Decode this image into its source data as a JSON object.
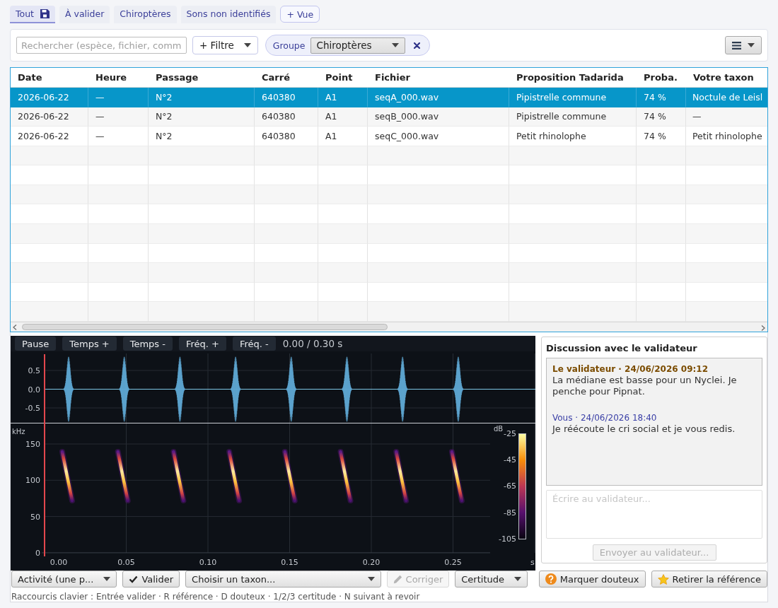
{
  "view_tabs": [
    {
      "label": "Tout",
      "selected": true,
      "saved": true
    },
    {
      "label": "À valider",
      "selected": false,
      "saved": false
    },
    {
      "label": "Chiroptères",
      "selected": false,
      "saved": false
    },
    {
      "label": "Sons non identifiés",
      "selected": false,
      "saved": false
    }
  ],
  "add_view_button": "+ Vue",
  "filter_bar": {
    "search": {
      "placeholder": "Rechercher (espèce, fichier, comm"
    },
    "filter_button": "+ Filtre",
    "chips": [
      {
        "label": "Groupe",
        "value": "Chiroptères"
      }
    ]
  },
  "table": {
    "columns": [
      "Date",
      "Heure",
      "Passage",
      "Carré",
      "Point",
      "Fichier",
      "Proposition Tadarida",
      "Proba.",
      "Votre taxon"
    ],
    "rows": [
      {
        "selected": true,
        "cells": [
          "2026-06-22",
          "—",
          "N°2",
          "640380",
          "A1",
          "seqA_000.wav",
          "Pipistrelle commune",
          "74 %",
          "Noctule de Leisl"
        ]
      },
      {
        "selected": false,
        "cells": [
          "2026-06-22",
          "—",
          "N°2",
          "640380",
          "A1",
          "seqB_000.wav",
          "Pipistrelle commune",
          "74 %",
          "—"
        ]
      },
      {
        "selected": false,
        "cells": [
          "2026-06-22",
          "—",
          "N°2",
          "640380",
          "A1",
          "seqC_000.wav",
          "Petit rhinolophe",
          "74 %",
          "Petit rhinolophe"
        ]
      }
    ]
  },
  "player": {
    "buttons": [
      "Pause",
      "Temps +",
      "Temps -",
      "Fréq. +",
      "Fréq. -"
    ],
    "time": "0.00 / 0.30 s",
    "waveform": {
      "yticks": [
        "0.5",
        "0.0",
        "-0.5"
      ]
    },
    "spectrogram": {
      "yunit": "kHz",
      "yticks": [
        "150",
        "100",
        "50",
        "0"
      ],
      "xticks": [
        "0.00",
        "0.05",
        "0.10",
        "0.15",
        "0.20",
        "0.25"
      ],
      "xunit": "s",
      "colorbar": {
        "unit": "dB",
        "ticks": [
          "-25",
          "-45",
          "-65",
          "-85",
          "-105"
        ]
      }
    }
  },
  "discussion": {
    "title": "Discussion avec le validateur",
    "messages": [
      {
        "kind": "validator",
        "header": "Le validateur · 24/06/2026 09:12",
        "text": "La médiane est basse pour un Nyclei. Je penche pour Pipnat."
      },
      {
        "kind": "self",
        "header": "Vous · 24/06/2026 18:40",
        "text": "Je réécoute le cri social et je vous redis."
      }
    ],
    "reply": {
      "placeholder": "Écrire au validateur..."
    },
    "send_button": {
      "label": "Envoyer au validateur...",
      "disabled": true
    }
  },
  "actions": {
    "left": [
      {
        "kind": "menu",
        "label": "Activité (une p...",
        "disabled": false
      },
      {
        "kind": "validate",
        "label": "Valider",
        "disabled": false
      },
      {
        "kind": "select",
        "label": "Choisir un taxon...",
        "disabled": false
      },
      {
        "kind": "correct",
        "label": "Corriger",
        "disabled": true
      },
      {
        "kind": "menu",
        "label": "Certitude",
        "disabled": false
      }
    ],
    "right": [
      {
        "kind": "flag",
        "label": "Marquer douteux",
        "disabled": false
      },
      {
        "kind": "unreference",
        "label": "Retirer la référence",
        "disabled": false
      }
    ]
  },
  "shortcuts": "Raccourcis clavier : Entrée valider · R référence · D douteux · 1/2/3 certitude · N suivant à revoir"
}
